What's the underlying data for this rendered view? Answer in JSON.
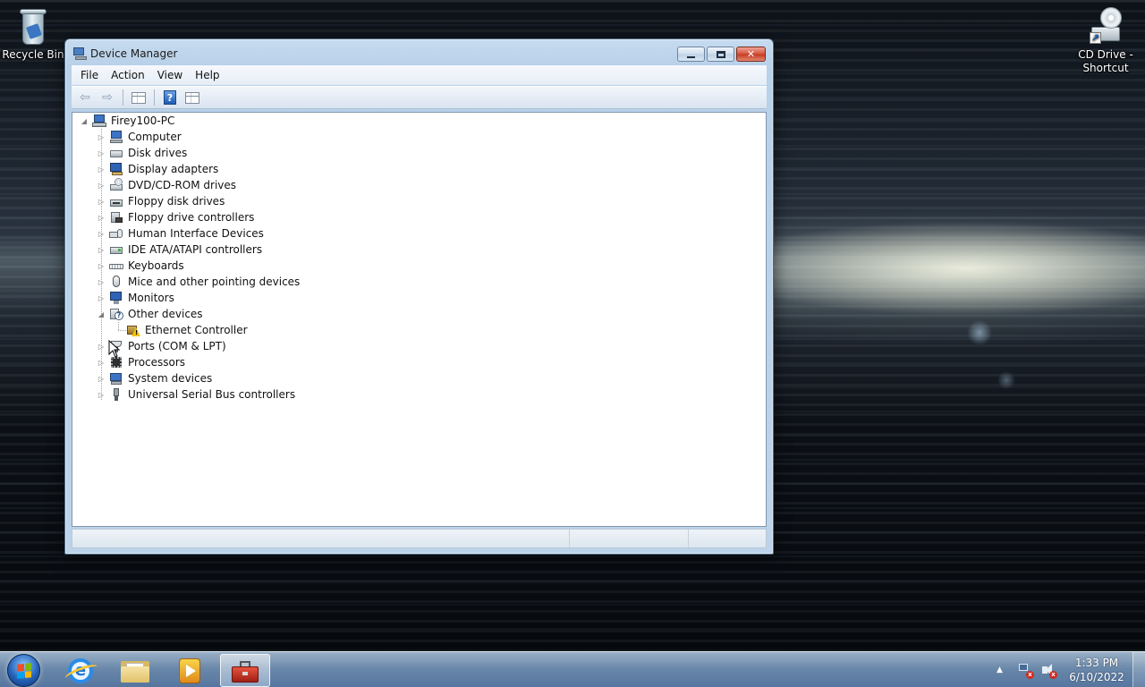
{
  "desktop": {
    "icons": [
      {
        "label": "Recycle Bin",
        "icon": "recycle-bin-icon"
      },
      {
        "label": "CD Drive - Shortcut",
        "icon": "cd-drive-shortcut-icon"
      }
    ]
  },
  "window": {
    "title": "Device Manager",
    "icon": "device-manager-icon",
    "caption_buttons": [
      "minimize",
      "maximize",
      "close"
    ],
    "close_glyph": "✕"
  },
  "menubar": {
    "items": [
      "File",
      "Action",
      "View",
      "Help"
    ]
  },
  "toolbar": {
    "buttons": [
      "back-arrow-icon",
      "forward-arrow-icon",
      "show-hide-console-tree-icon",
      "help-icon",
      "properties-icon"
    ],
    "back_glyph": "⇦",
    "forward_glyph": "⇨",
    "help_glyph": "?"
  },
  "tree": {
    "root": {
      "label": "Firey100-PC",
      "expanded": true
    },
    "categories": [
      {
        "label": "Computer",
        "icon": "computer-icon",
        "expanded": false
      },
      {
        "label": "Disk drives",
        "icon": "disk-drive-icon",
        "expanded": false
      },
      {
        "label": "Display adapters",
        "icon": "display-adapter-icon",
        "expanded": false
      },
      {
        "label": "DVD/CD-ROM drives",
        "icon": "dvd-drive-icon",
        "expanded": false
      },
      {
        "label": "Floppy disk drives",
        "icon": "floppy-disk-icon",
        "expanded": false
      },
      {
        "label": "Floppy drive controllers",
        "icon": "floppy-controller-icon",
        "expanded": false
      },
      {
        "label": "Human Interface Devices",
        "icon": "hid-icon",
        "expanded": false
      },
      {
        "label": "IDE ATA/ATAPI controllers",
        "icon": "ide-controller-icon",
        "expanded": false
      },
      {
        "label": "Keyboards",
        "icon": "keyboard-icon",
        "expanded": false
      },
      {
        "label": "Mice and other pointing devices",
        "icon": "mouse-icon",
        "expanded": false
      },
      {
        "label": "Monitors",
        "icon": "monitor-icon",
        "expanded": false
      },
      {
        "label": "Other devices",
        "icon": "other-devices-icon",
        "expanded": true,
        "children": [
          {
            "label": "Ethernet Controller",
            "icon": "ethernet-warning-icon",
            "warning": true
          }
        ]
      },
      {
        "label": "Ports (COM & LPT)",
        "icon": "port-icon",
        "expanded": false
      },
      {
        "label": "Processors",
        "icon": "processor-icon",
        "expanded": false
      },
      {
        "label": "System devices",
        "icon": "system-devices-icon",
        "expanded": false
      },
      {
        "label": "Universal Serial Bus controllers",
        "icon": "usb-icon",
        "expanded": false
      }
    ],
    "expanded_glyph": "◢",
    "collapsed_glyph": "▷",
    "other_devices_badge": "?",
    "warning_badge": "!"
  },
  "taskbar": {
    "pinned": [
      {
        "name": "internet-explorer",
        "icon": "internet-explorer-icon",
        "glyph": "e"
      },
      {
        "name": "windows-explorer",
        "icon": "folder-icon"
      },
      {
        "name": "windows-media-player",
        "icon": "media-player-icon"
      },
      {
        "name": "device-manager",
        "icon": "toolbox-icon",
        "active": true
      }
    ],
    "tray": {
      "show_hidden_glyph": "▲",
      "icons": [
        "network-disconnected-icon",
        "volume-muted-icon"
      ],
      "badge_glyph": "x",
      "time": "1:33 PM",
      "date": "6/10/2022"
    }
  },
  "colors": {
    "titlebar": "#c6dbef",
    "taskbar": "#7f9fc6",
    "warning": "#f4c20d",
    "close_button": "#c43a22"
  }
}
